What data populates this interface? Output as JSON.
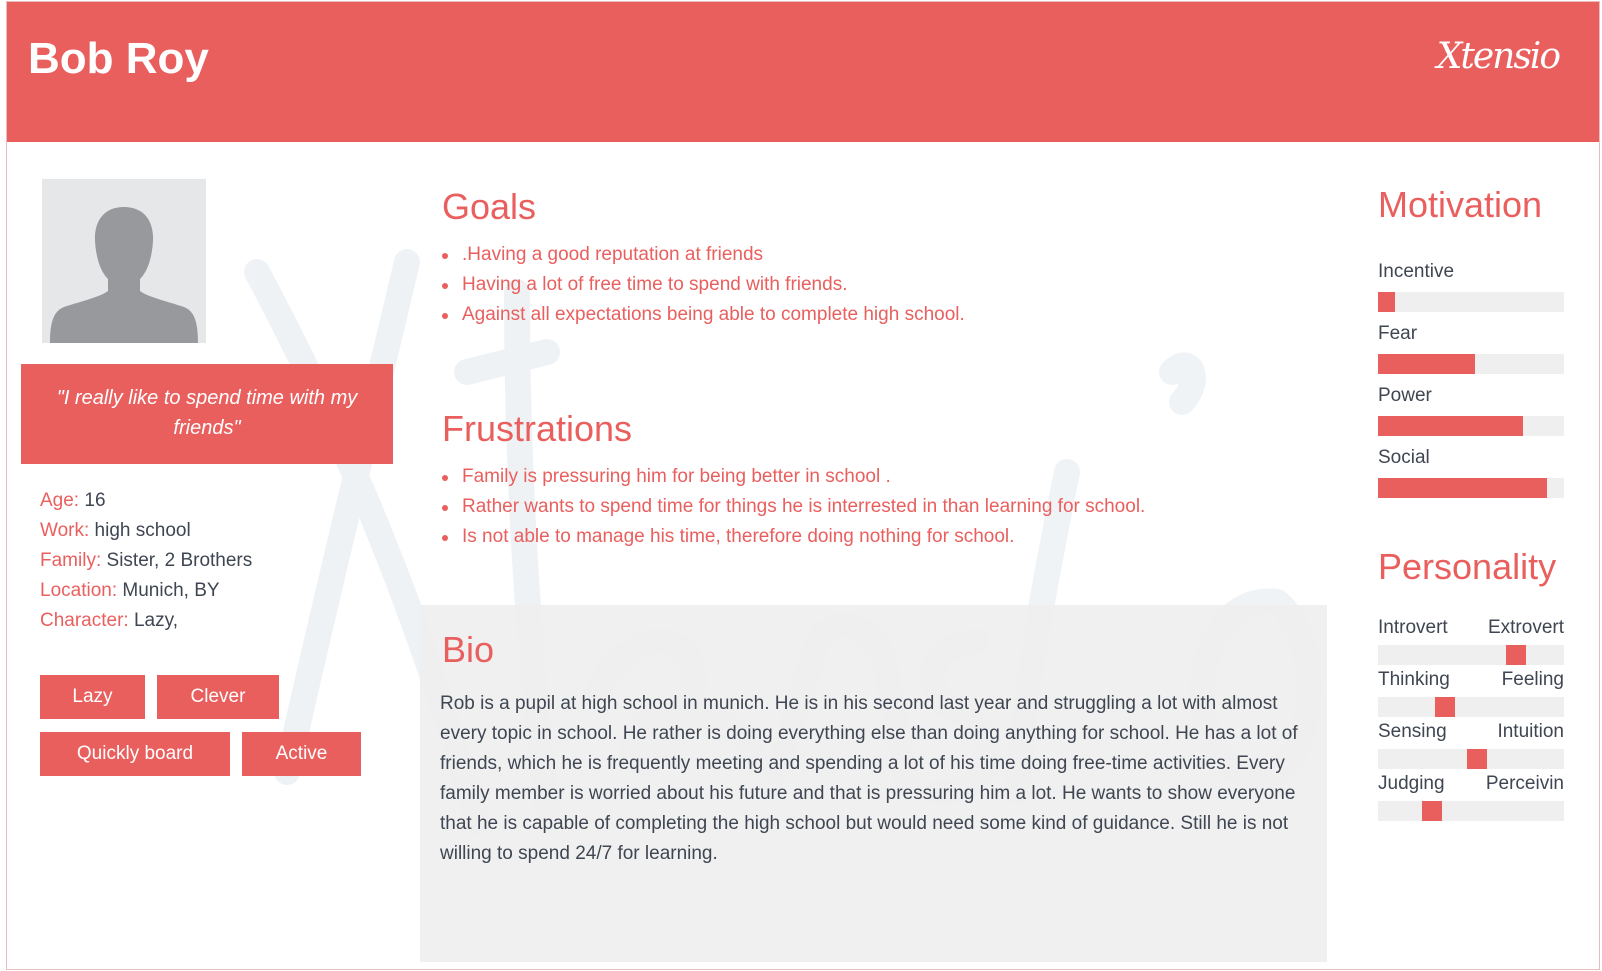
{
  "header": {
    "name": "Bob Roy",
    "logo": "Xtensio"
  },
  "profile": {
    "quote": "\"I really like to spend time with my friends\"",
    "facts": [
      {
        "label": "Age:",
        "value": "16"
      },
      {
        "label": "Work:",
        "value": "high school"
      },
      {
        "label": "Family:",
        "value": "Sister, 2 Brothers"
      },
      {
        "label": "Location:",
        "value": "Munich, BY"
      },
      {
        "label": "Character:",
        "value": "Lazy,"
      }
    ],
    "tags": [
      "Lazy",
      "Clever",
      "Quickly board",
      "Active"
    ]
  },
  "goals": {
    "title": "Goals",
    "items": [
      ".Having a good reputation at friends",
      "Having a lot of free time to spend with friends.",
      "Against all expectations being able to complete high school."
    ]
  },
  "frustrations": {
    "title": "Frustrations",
    "items": [
      "Family is pressuring him for being better in school .",
      "Rather wants to spend time for things he is interrested in than learning for school.",
      "Is not able to manage his time, therefore doing nothing for school."
    ]
  },
  "bio": {
    "title": "Bio",
    "text": "Rob is a pupil at high school in munich. He is in his second last year and struggling a lot with almost every topic in school. He rather is doing everything else than doing anything for school. He has a lot of friends, which he is frequently meeting and spending a lot of his time doing free-time activities. Every family member is worried about his future and that is pressuring him a lot. He wants to show everyone that he is capable of completing the high school but would need some kind of guidance. Still he is not willing to spend 24/7 for learning."
  },
  "motivation": {
    "title": "Motivation",
    "items": [
      {
        "label": "Incentive",
        "value": 0.09
      },
      {
        "label": "Fear",
        "value": 0.52
      },
      {
        "label": "Power",
        "value": 0.78
      },
      {
        "label": "Social",
        "value": 0.91
      }
    ]
  },
  "personality": {
    "title": "Personality",
    "items": [
      {
        "left": "Introvert",
        "right": "Extrovert",
        "value": 0.74
      },
      {
        "left": "Thinking",
        "right": "Feeling",
        "value": 0.36
      },
      {
        "left": "Sensing",
        "right": "Intuition",
        "value": 0.53
      },
      {
        "left": "Judging",
        "right": "Perceivin",
        "value": 0.29
      }
    ]
  },
  "colors": {
    "accent": "#e95f5e",
    "panel": "#efefef",
    "text": "#3f4652"
  }
}
